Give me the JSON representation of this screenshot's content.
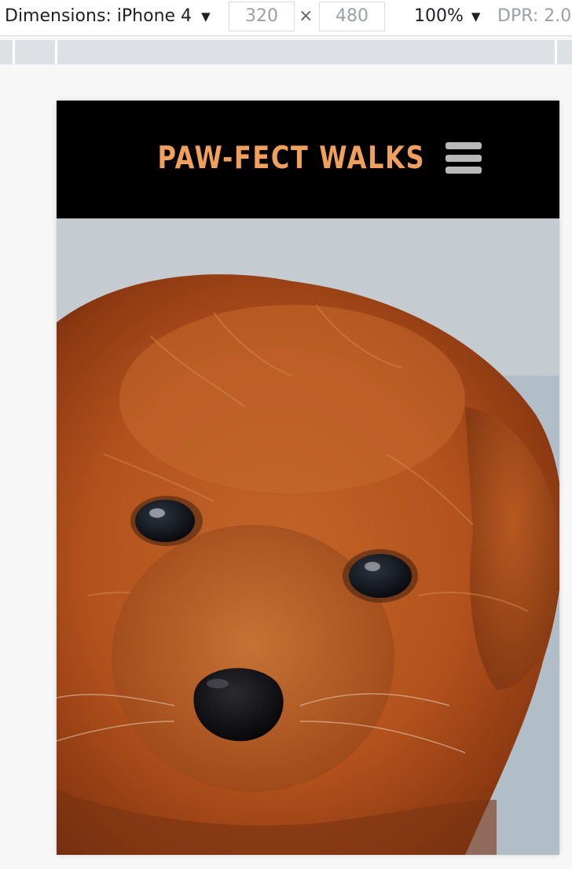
{
  "devtools": {
    "dimensions_label": "Dimensions: iPhone 4",
    "width_value": "320",
    "height_value": "480",
    "times_symbol": "×",
    "zoom_label": "100%",
    "dpr_label": "DPR: 2.0",
    "caret": "▼"
  },
  "site": {
    "brand": "PAW-FECT WALKS",
    "brand_color": "#f0a05a",
    "header_background": "#000000",
    "menu_icon": "hamburger-menu-icon"
  },
  "hero": {
    "image_subject": "red-brown puppy close-up"
  }
}
